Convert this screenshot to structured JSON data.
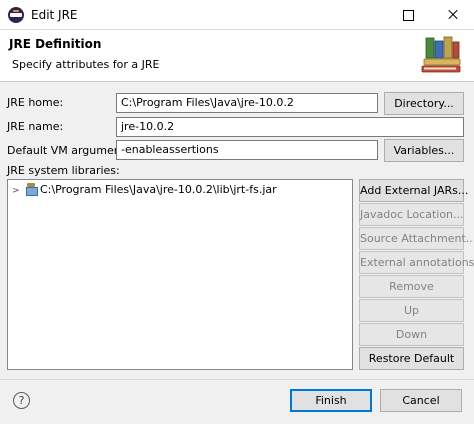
{
  "window": {
    "title": "Edit JRE"
  },
  "header": {
    "title": "JRE Definition",
    "subtitle": "Specify attributes for a JRE"
  },
  "form": {
    "jre_home_label": "JRE home:",
    "jre_home_value": "C:\\Program Files\\Java\\jre-10.0.2",
    "jre_name_label": "JRE name:",
    "jre_name_value": "jre-10.0.2",
    "vm_args_label": "Default VM arguments:",
    "vm_args_value": "-enableassertions",
    "directory_button": "Directory...",
    "variables_button": "Variables...",
    "libraries_label": "JRE system libraries:"
  },
  "libraries": {
    "items": [
      {
        "label": "C:\\Program Files\\Java\\jre-10.0.2\\lib\\jrt-fs.jar",
        "icon": "jar-icon"
      }
    ]
  },
  "side_buttons": {
    "add_external_jars": "Add External JARs...",
    "javadoc_location": "Javadoc Location...",
    "source_attachment": "Source Attachment...",
    "external_annotations": "External annotations...",
    "remove": "Remove",
    "up": "Up",
    "down": "Down",
    "restore_default": "Restore Default"
  },
  "footer": {
    "finish": "Finish",
    "cancel": "Cancel"
  },
  "colors": {
    "accent": "#0078d7",
    "dialog_bg": "#f0f0f0",
    "header_bg": "#ffffff"
  }
}
